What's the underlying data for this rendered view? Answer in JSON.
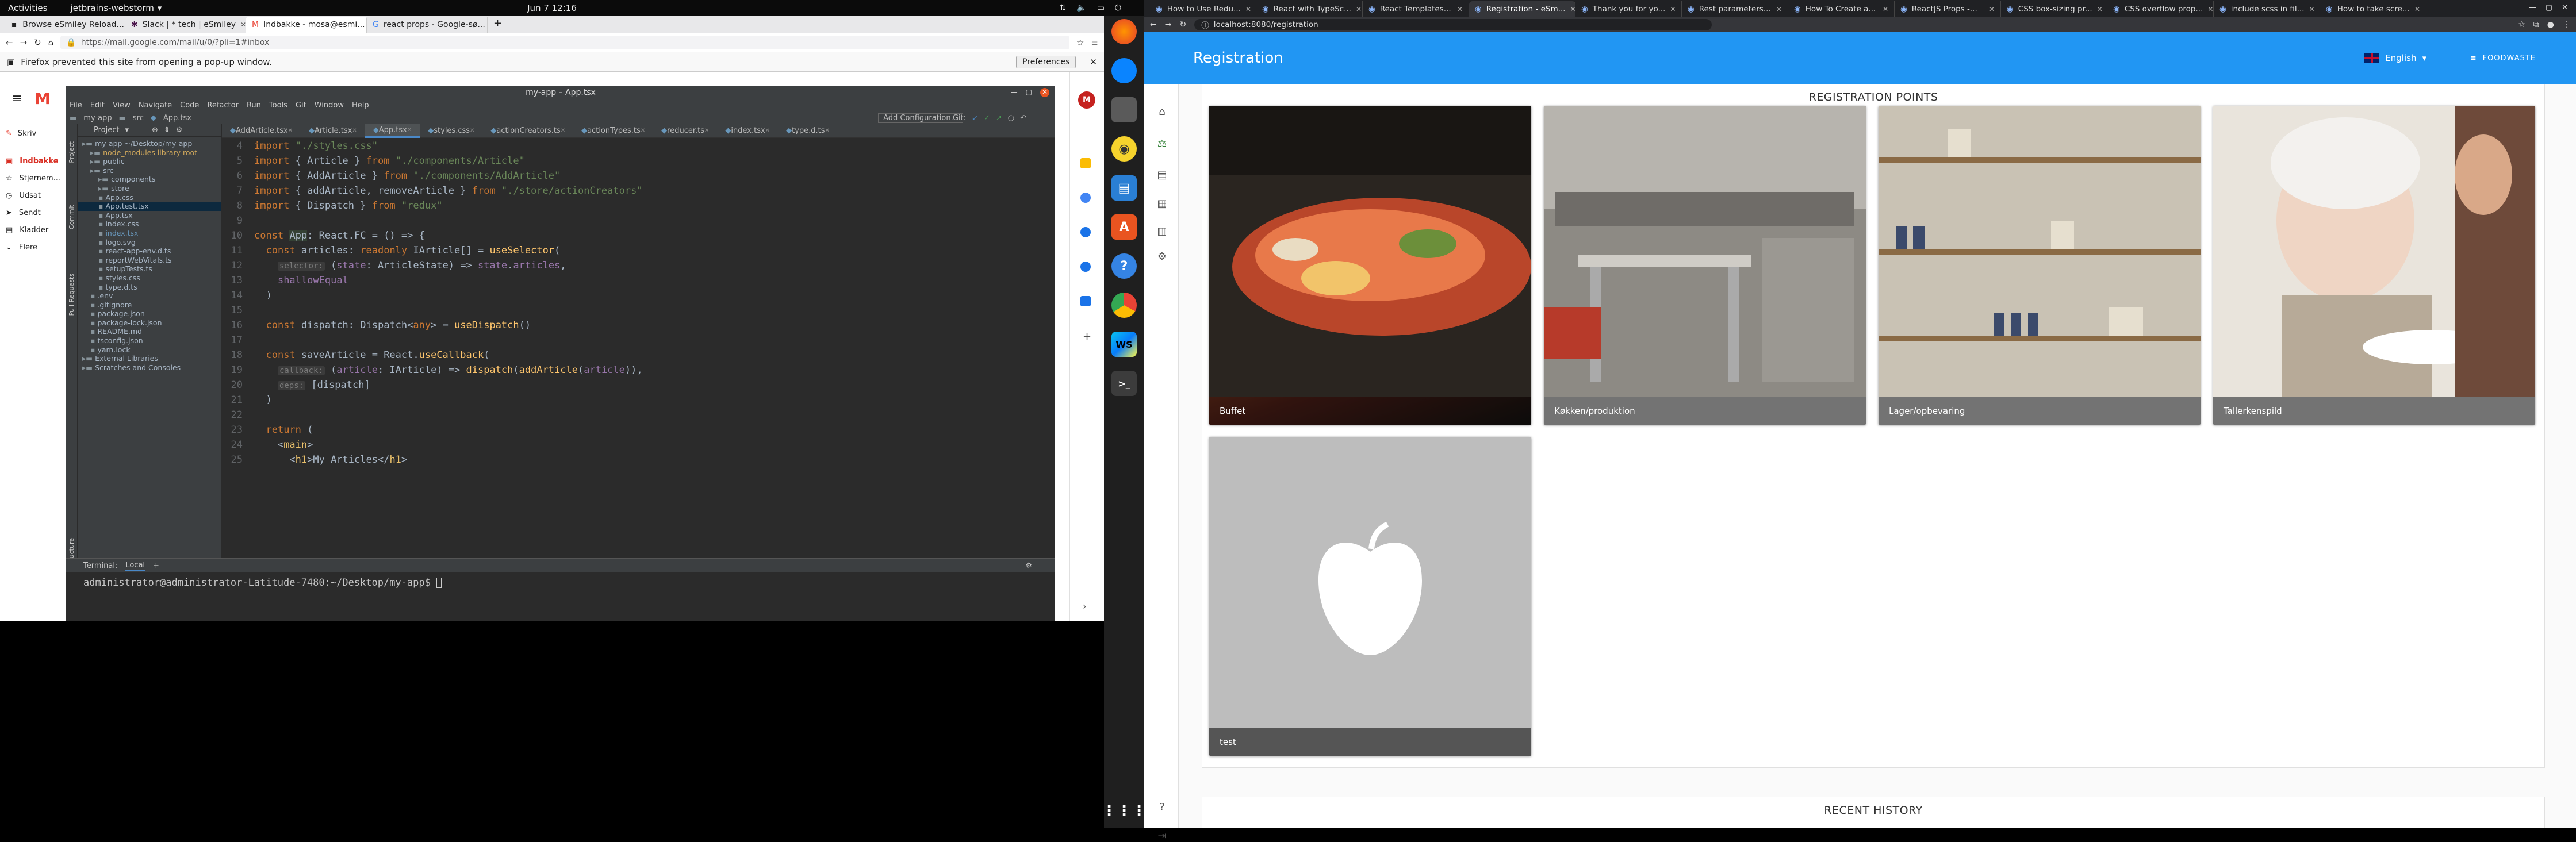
{
  "topbar": {
    "activities": "Activities",
    "app_menu": "jetbrains-webstorm",
    "clock": "Jun 7  12:16"
  },
  "firefox": {
    "tabs": [
      {
        "label": "Browse eSmiley Reload..."
      },
      {
        "label": "Slack | * tech | eSmiley"
      },
      {
        "label": "Indbakke - mosa@esmi..."
      },
      {
        "label": "react props - Google-sø..."
      }
    ],
    "url": "https://mail.google.com/mail/u/0/?pli=1#inbox",
    "notification": "Firefox prevented this site from opening a pop-up window.",
    "preferences": "Preferences"
  },
  "gmail": {
    "logo": "M",
    "compose": "Skriv",
    "folders": [
      "Indbakke",
      "Stjernem...",
      "Udsat",
      "Sendt",
      "Kladder",
      "Flere"
    ]
  },
  "ide": {
    "title": "my-app – App.tsx",
    "menu": [
      "File",
      "Edit",
      "View",
      "Navigate",
      "Code",
      "Refactor",
      "Run",
      "Tools",
      "Git",
      "Window",
      "Help"
    ],
    "breadcrumbs": [
      "my-app",
      "src",
      "App.tsx"
    ],
    "add_config": "Add Configuration...",
    "git_label": "Git:",
    "project_label": "Project",
    "tree": [
      {
        "name": "my-app  ~/Desktop/my-app",
        "depth": 0,
        "color": "#a9b7c6"
      },
      {
        "name": "node_modules  library root",
        "depth": 1,
        "color": "#d0a85c"
      },
      {
        "name": "public",
        "depth": 1,
        "color": "#a9b7c6"
      },
      {
        "name": "src",
        "depth": 1,
        "color": "#a9b7c6"
      },
      {
        "name": "components",
        "depth": 2,
        "color": "#a9b7c6"
      },
      {
        "name": "store",
        "depth": 2,
        "color": "#a9b7c6"
      },
      {
        "name": "App.css",
        "depth": 2,
        "color": "#a9b7c6"
      },
      {
        "name": "App.test.tsx",
        "depth": 2,
        "color": "#a9b7c6",
        "selected": true
      },
      {
        "name": "App.tsx",
        "depth": 2,
        "color": "#a9b7c6"
      },
      {
        "name": "index.css",
        "depth": 2,
        "color": "#a9b7c6"
      },
      {
        "name": "index.tsx",
        "depth": 2,
        "color": "#6897bb"
      },
      {
        "name": "logo.svg",
        "depth": 2,
        "color": "#a9b7c6"
      },
      {
        "name": "react-app-env.d.ts",
        "depth": 2,
        "color": "#a9b7c6"
      },
      {
        "name": "reportWebVitals.ts",
        "depth": 2,
        "color": "#a9b7c6"
      },
      {
        "name": "setupTests.ts",
        "depth": 2,
        "color": "#a9b7c6"
      },
      {
        "name": "styles.css",
        "depth": 2,
        "color": "#a9b7c6"
      },
      {
        "name": "type.d.ts",
        "depth": 2,
        "color": "#a9b7c6"
      },
      {
        "name": ".env",
        "depth": 1,
        "color": "#a9b7c6"
      },
      {
        "name": ".gitignore",
        "depth": 1,
        "color": "#a9b7c6"
      },
      {
        "name": "package.json",
        "depth": 1,
        "color": "#a9b7c6"
      },
      {
        "name": "package-lock.json",
        "depth": 1,
        "color": "#a9b7c6"
      },
      {
        "name": "README.md",
        "depth": 1,
        "color": "#a9b7c6"
      },
      {
        "name": "tsconfig.json",
        "depth": 1,
        "color": "#a9b7c6"
      },
      {
        "name": "yarn.lock",
        "depth": 1,
        "color": "#a9b7c6"
      },
      {
        "name": "External Libraries",
        "depth": 0,
        "color": "#a9b7c6"
      },
      {
        "name": "Scratches and Consoles",
        "depth": 0,
        "color": "#a9b7c6"
      }
    ],
    "editor_tabs": [
      "AddArticle.tsx",
      "Article.tsx",
      "App.tsx",
      "styles.css",
      "actionCreators.ts",
      "actionTypes.ts",
      "reducer.ts",
      "index.tsx",
      "type.d.ts"
    ],
    "active_tab": "App.tsx",
    "terminal_label": "Terminal:",
    "terminal_tab": "Local",
    "terminal_prompt": "administrator@administrator-Latitude-7480:~/Desktop/my-app$"
  },
  "chrome": {
    "tabs": [
      {
        "label": "How to Use Redu..."
      },
      {
        "label": "React with TypeSc..."
      },
      {
        "label": "React Templates..."
      },
      {
        "label": "Registration - eSm..."
      },
      {
        "label": "Thank you for yo..."
      },
      {
        "label": "Rest parameters..."
      },
      {
        "label": "How To Create a..."
      },
      {
        "label": "ReactJS Props -..."
      },
      {
        "label": "CSS box-sizing pr..."
      },
      {
        "label": "CSS overflow prop..."
      },
      {
        "label": "include scss in fil..."
      },
      {
        "label": "How to take scre..."
      }
    ],
    "url": "localhost:8080/registration"
  },
  "app": {
    "title": "Registration",
    "language": "English",
    "brand": "FOODWASTE",
    "section_title": "REGISTRATION POINTS",
    "cards": [
      {
        "label": "Buffet"
      },
      {
        "label": "Køkken/produktion"
      },
      {
        "label": "Lager/opbevaring"
      },
      {
        "label": "Tallerkenspild"
      },
      {
        "label": "test"
      }
    ],
    "recent_title": "RECENT HISTORY"
  }
}
